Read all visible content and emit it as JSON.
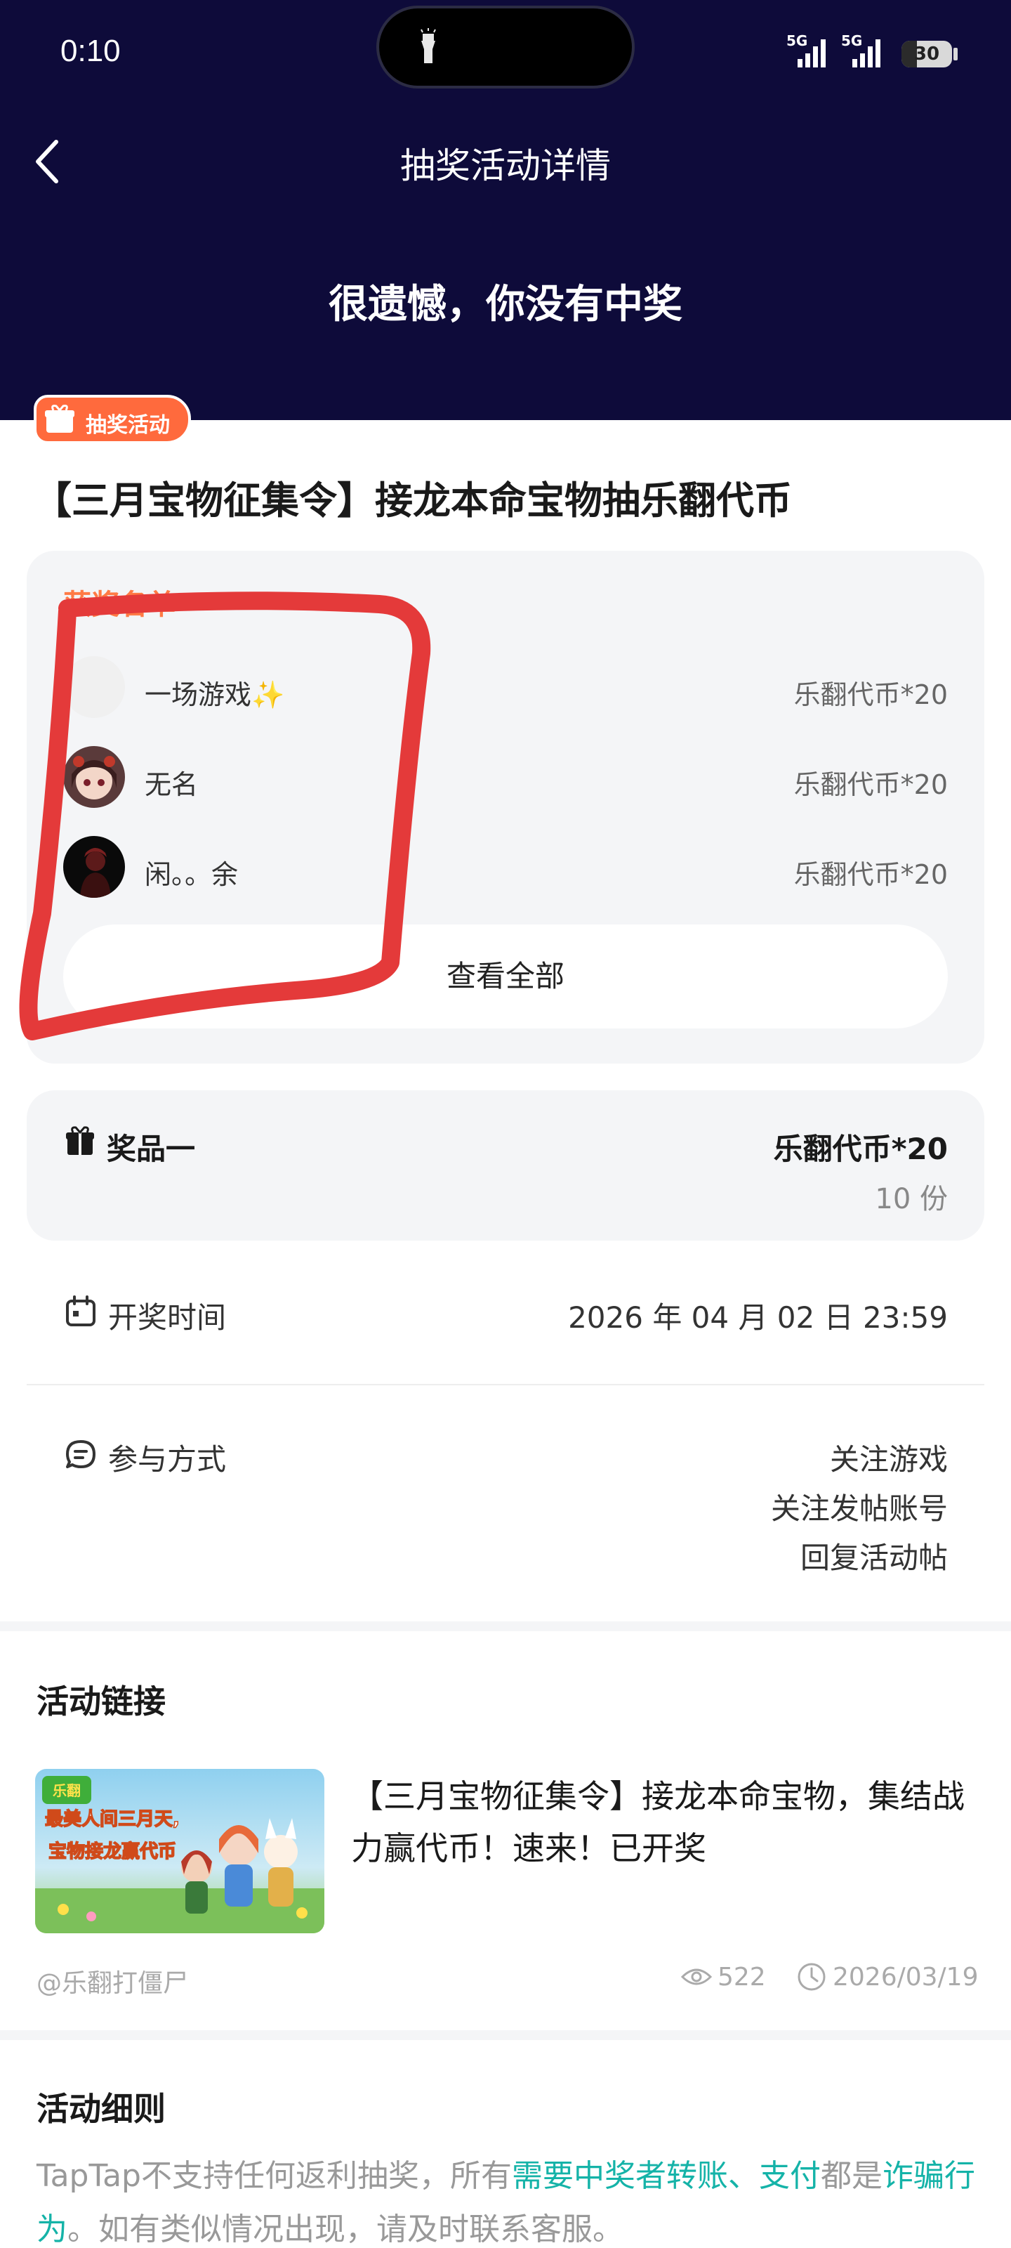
{
  "status_bar": {
    "time": "0:10",
    "network": "5G",
    "battery": "30",
    "battery_level": 0.3
  },
  "nav": {
    "title": "抽奖活动详情",
    "back_icon": "chevron-left-icon"
  },
  "result_text": "很遗憾，你没有中奖",
  "tag": {
    "label": "抽奖活动",
    "icon": "gift-icon"
  },
  "activity_title": "【三月宝物征集令】接龙本命宝物抽乐翻代币",
  "winners": {
    "heading": "获奖名单",
    "list": [
      {
        "name": "一场游戏✨",
        "prize": "乐翻代币*20"
      },
      {
        "name": "无名",
        "prize": "乐翻代币*20"
      },
      {
        "name": "闲。。余",
        "prize": "乐翻代币*20"
      }
    ],
    "view_all": "查看全部"
  },
  "prize": {
    "label": "奖品一",
    "value": "乐翻代币*20",
    "count": "10 份"
  },
  "draw_time": {
    "label": "开奖时间",
    "value": "2026 年 04 月 02 日 23:59"
  },
  "participation": {
    "label": "参与方式",
    "methods": [
      "关注游戏",
      "关注发帖账号",
      "回复活动帖"
    ]
  },
  "activity_link": {
    "heading": "活动链接",
    "thumb_text_line1": "最美人间三月天,",
    "thumb_text_line2": "宝物接龙赢代币",
    "title": "【三月宝物征集令】接龙本命宝物，集结战力赢代币！速来！已开奖",
    "author": "@乐翻打僵尸",
    "views": "522",
    "date": "2026/03/19"
  },
  "rules": {
    "heading": "活动细则",
    "text_part1": "TapTap不支持任何返利抽奖，所有",
    "text_highlight1": "需要中奖者转账、支付",
    "text_part2": "都是",
    "text_highlight2": "诈骗行为",
    "text_part3": "。如有类似情况出现，请及时联系客服。"
  },
  "colors": {
    "header_bg": "#0e0b3a",
    "tag_orange": "#ff6a3d",
    "winners_heading": "#ff7a45",
    "highlight_teal": "#15b3a8",
    "red_mark": "#e43a3a"
  }
}
